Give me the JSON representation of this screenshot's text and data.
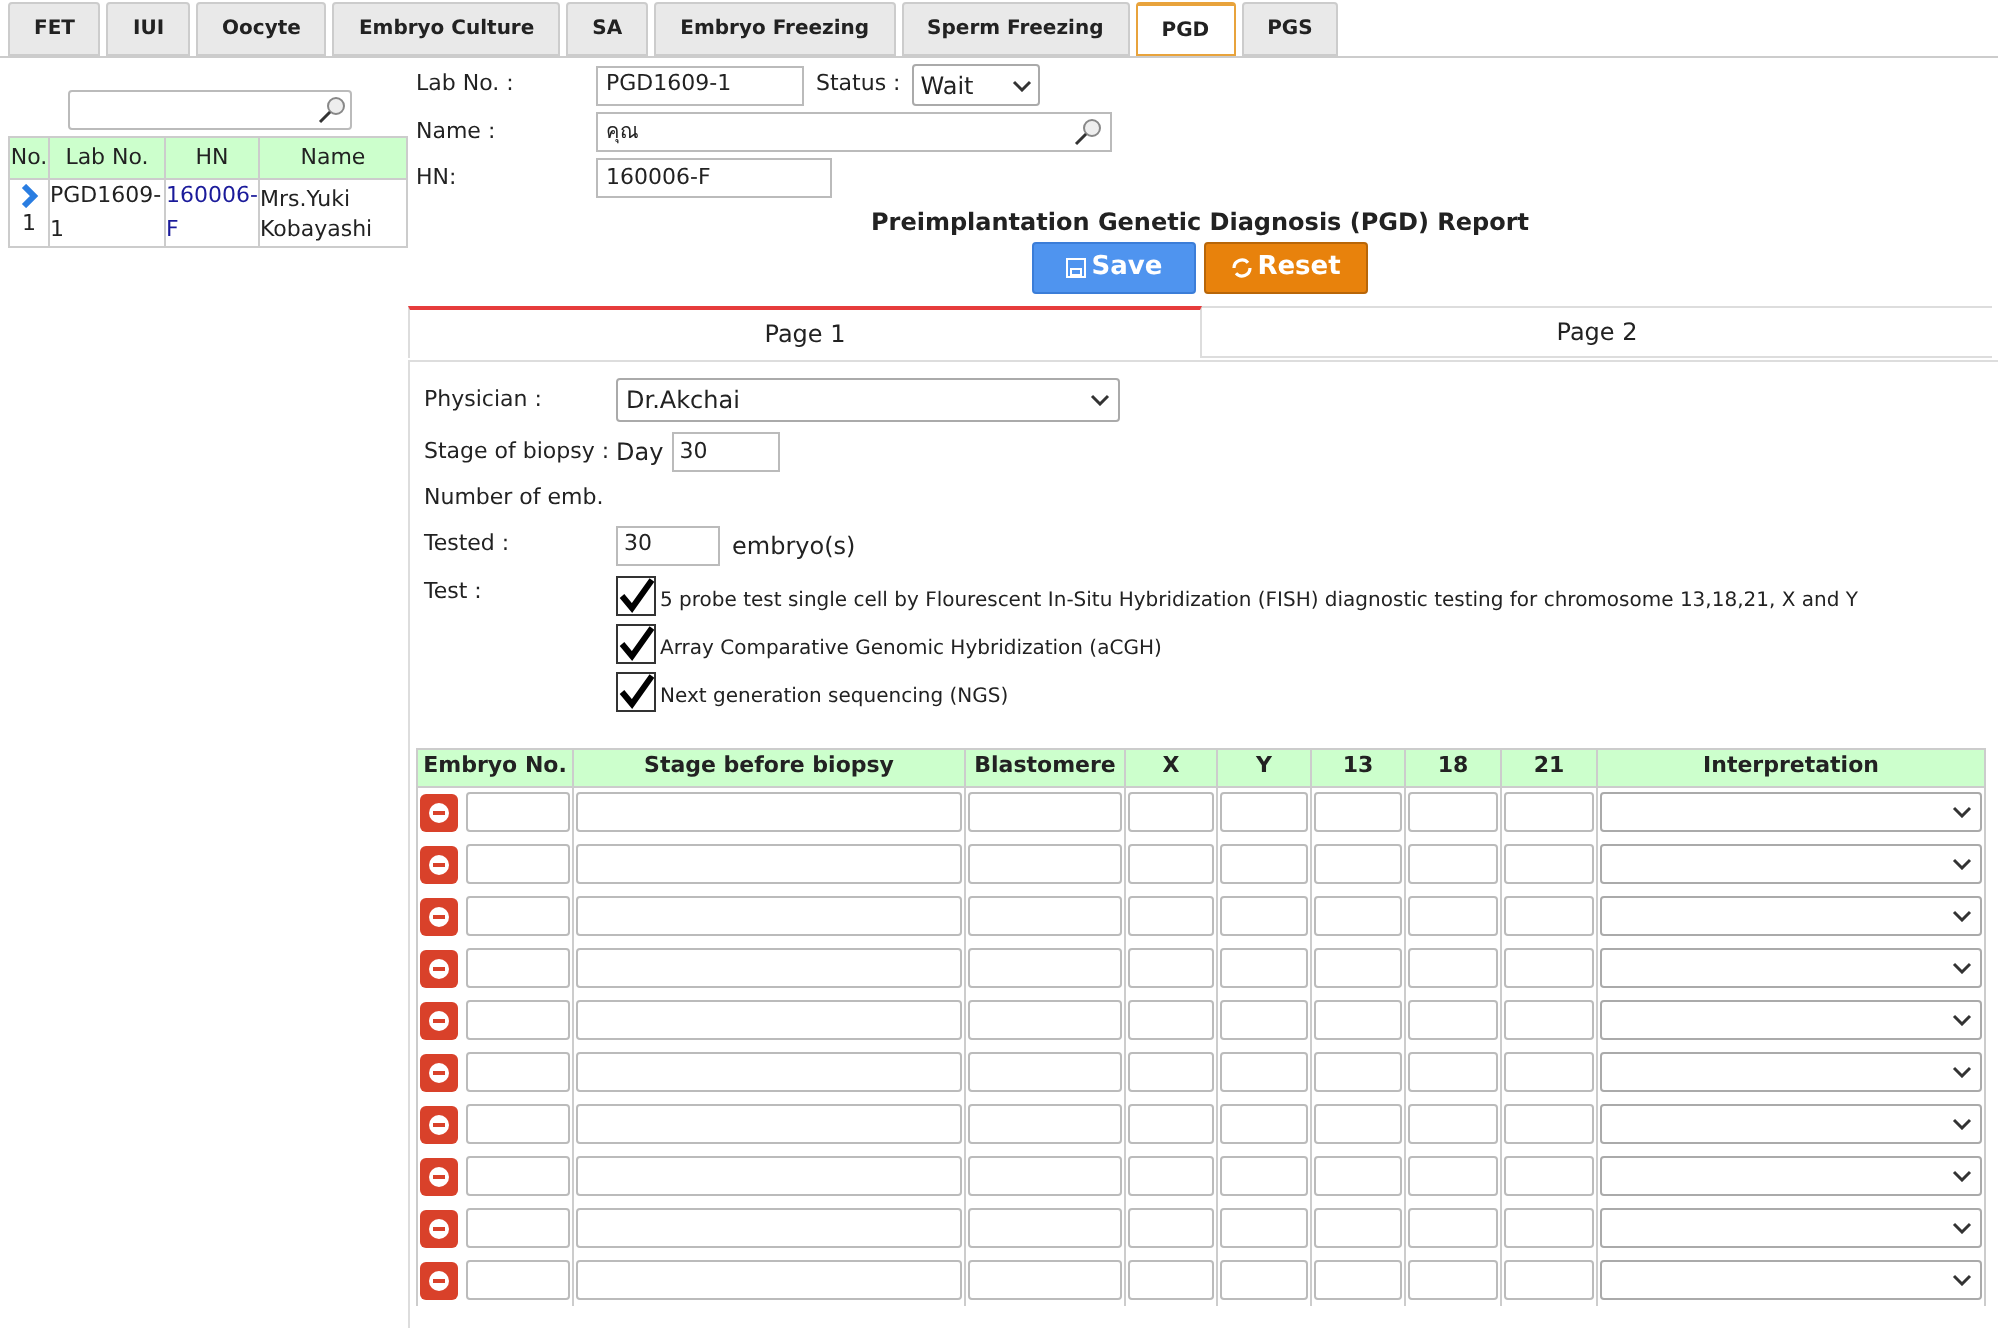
{
  "tabs": [
    {
      "label": "FET",
      "selected": false
    },
    {
      "label": "IUI",
      "selected": false
    },
    {
      "label": "Oocyte",
      "selected": false
    },
    {
      "label": "Embryo Culture",
      "selected": false
    },
    {
      "label": "SA",
      "selected": false
    },
    {
      "label": "Embryo Freezing",
      "selected": false
    },
    {
      "label": "Sperm Freezing",
      "selected": false
    },
    {
      "label": "PGD",
      "selected": true
    },
    {
      "label": "PGS",
      "selected": false
    }
  ],
  "patient_list": {
    "columns": [
      "No.",
      "Lab No.",
      "HN",
      "Name"
    ],
    "rows": [
      {
        "no": "1",
        "lab_no": "PGD1609-1",
        "hn": "160006-F",
        "name": "Mrs.Yuki Kobayashi"
      }
    ]
  },
  "header": {
    "lab_no_label": "Lab No. :",
    "lab_no": "PGD1609-1",
    "status_label": "Status :",
    "status": "Wait",
    "name_label": "Name :",
    "name": "คุณ",
    "hn_label": "HN:",
    "hn": "160006-F"
  },
  "report_title": "Preimplantation Genetic Diagnosis (PGD) Report",
  "buttons": [
    {
      "label": "Save",
      "kind": "save"
    },
    {
      "label": "Reset",
      "kind": "reset"
    }
  ],
  "page_tabs": [
    {
      "label": "Page 1",
      "selected": true
    },
    {
      "label": "Page 2",
      "selected": false
    }
  ],
  "form": {
    "physician_label": "Physician :",
    "physician": "Dr.Akchai",
    "stage_label": "Stage of biopsy :",
    "day_label": "Day",
    "day": "30",
    "number_label": "Number of emb.",
    "tested_label": "Tested :",
    "tested": "30",
    "tested_unit": "embryo(s)",
    "test_label": "Test :",
    "tests": [
      {
        "label": "5 probe test single cell by Flourescent In-Situ Hybridization (FISH) diagnostic testing for chromosome 13,18,21, X and Y",
        "checked": true
      },
      {
        "label": "Array Comparative Genomic Hybridization (aCGH)",
        "checked": true
      },
      {
        "label": "Next generation sequencing (NGS)",
        "checked": true
      }
    ]
  },
  "table": {
    "columns": [
      "Embryo No.",
      "Stage before biopsy",
      "Blastomere",
      "X",
      "Y",
      "13",
      "18",
      "21",
      "Interpretation"
    ],
    "rows": [
      {
        "kind": "entry"
      },
      {
        "kind": "entry"
      },
      {
        "kind": "entry"
      },
      {
        "kind": "entry"
      },
      {
        "kind": "entry"
      },
      {
        "kind": "entry"
      },
      {
        "kind": "entry"
      },
      {
        "kind": "entry"
      },
      {
        "kind": "entry"
      },
      {
        "kind": "entry"
      }
    ]
  }
}
